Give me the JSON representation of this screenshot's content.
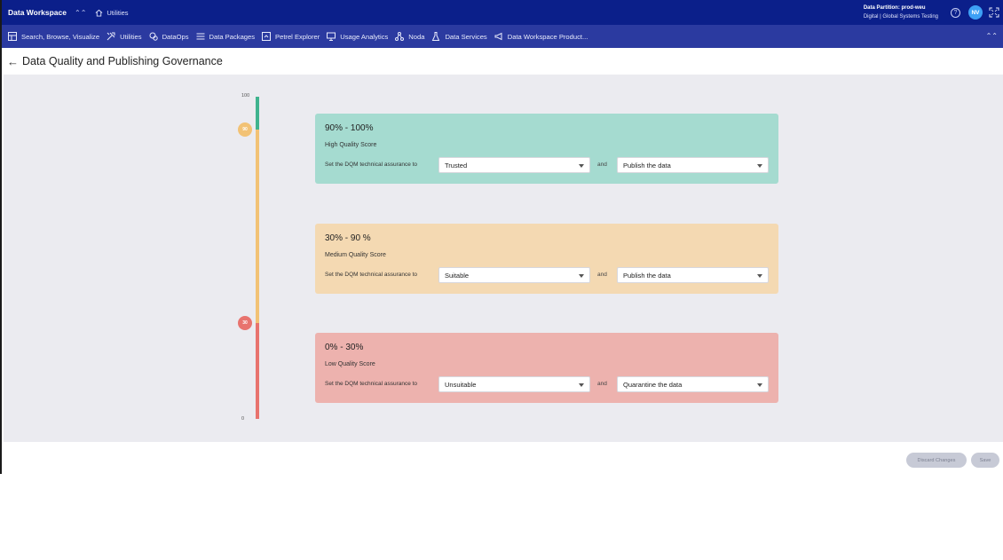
{
  "topbar": {
    "app_title": "Data Workspace",
    "breadcrumb": "Utilities",
    "partition_line1": "Data Partition: prod-weu",
    "partition_line2": "Digital | Global Systems Testing",
    "help_glyph": "?",
    "avatar_initials": "NV"
  },
  "nav": {
    "items": [
      {
        "label": "Search, Browse, Visualize",
        "icon": "grid-icon"
      },
      {
        "label": "Utilities",
        "icon": "tools-icon"
      },
      {
        "label": "DataOps",
        "icon": "dataops-icon"
      },
      {
        "label": "Data Packages",
        "icon": "list-icon"
      },
      {
        "label": "Petrel Explorer",
        "icon": "explorer-icon"
      },
      {
        "label": "Usage Analytics",
        "icon": "monitor-icon"
      },
      {
        "label": "Noda",
        "icon": "nodes-icon"
      },
      {
        "label": "Data Services",
        "icon": "flask-icon"
      },
      {
        "label": "Data Workspace Product...",
        "icon": "megaphone-icon"
      }
    ]
  },
  "page": {
    "title": "Data Quality and Publishing Governance"
  },
  "scale": {
    "top": "100",
    "bottom": "0",
    "high_marker": "90",
    "low_marker": "30",
    "colors": {
      "high": "#3fb38e",
      "medium": "#f2c275",
      "low": "#e8736e"
    }
  },
  "tiers": [
    {
      "range": "90% - 100%",
      "label": "High Quality Score",
      "assurance_prefix": "Set the DQM technical assurance to",
      "assurance": "Trusted",
      "conjunction": "and",
      "action": "Publish the data",
      "color": "#a5dbd0"
    },
    {
      "range": "30% - 90 %",
      "label": "Medium Quality Score",
      "assurance_prefix": "Set the DQM technical assurance to",
      "assurance": "Suitable",
      "conjunction": "and",
      "action": "Publish the data",
      "color": "#f4d9b2"
    },
    {
      "range": "0% - 30%",
      "label": "Low Quality Score",
      "assurance_prefix": "Set the DQM technical assurance to",
      "assurance": "Unsuitable",
      "conjunction": "and",
      "action": "Quarantine the data",
      "color": "#edb2ae"
    }
  ],
  "footer": {
    "discard_label": "Discard Changes",
    "save_label": "Save"
  }
}
